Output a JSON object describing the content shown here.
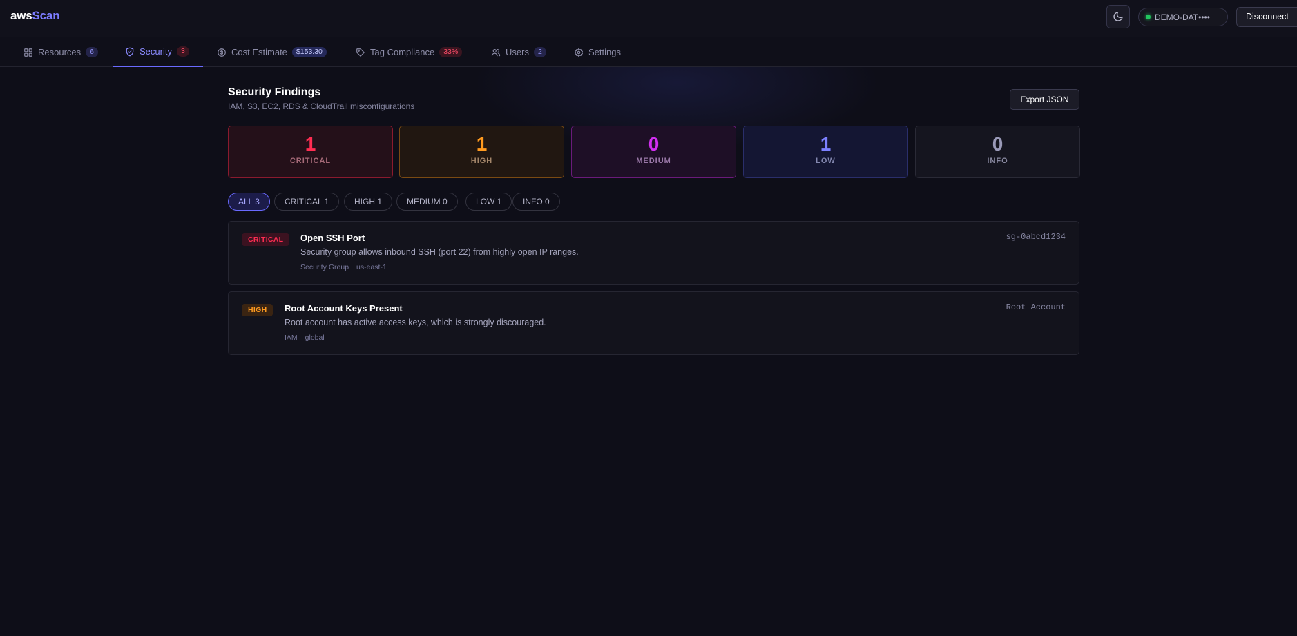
{
  "app": {
    "logo_part1": "aws",
    "logo_part2": "Scan"
  },
  "topbar": {
    "theme_toggle_icon": "moon-icon",
    "account": {
      "label": "DEMO-DAT••••",
      "status": "connected",
      "status_color": "#22c55e"
    },
    "disconnect_label": "Disconnect"
  },
  "tabs": [
    {
      "label": "Resources",
      "badge": "6",
      "icon": "grid-icon",
      "active": false
    },
    {
      "label": "Security",
      "badge": "3",
      "icon": "shield-icon",
      "active": true
    },
    {
      "label": "Cost Estimate",
      "badge": "$153.30",
      "icon": "dollar-icon",
      "active": false
    },
    {
      "label": "Tag Compliance",
      "badge": "33%",
      "icon": "tag-icon",
      "active": false
    },
    {
      "label": "Users",
      "badge": "2",
      "icon": "users-icon",
      "active": false
    },
    {
      "label": "Settings",
      "badge": "",
      "icon": "gear-icon",
      "active": false
    }
  ],
  "page": {
    "title": "Security Findings",
    "subtitle": "IAM, S3, EC2, RDS & CloudTrail misconfigurations",
    "export_label": "Export JSON"
  },
  "summary": [
    {
      "count": "1",
      "label": "CRITICAL",
      "color": "#ff2d52"
    },
    {
      "count": "1",
      "label": "HIGH",
      "color": "#ff9a1f"
    },
    {
      "count": "0",
      "label": "MEDIUM",
      "color": "#d12ef0"
    },
    {
      "count": "1",
      "label": "LOW",
      "color": "#7c80ff"
    },
    {
      "count": "0",
      "label": "INFO",
      "color": "#9a9ab8"
    }
  ],
  "filters": [
    {
      "label": "ALL 3",
      "active": true
    },
    {
      "label": "CRITICAL 1",
      "active": false
    },
    {
      "label": "HIGH 1",
      "active": false
    },
    {
      "label": "MEDIUM 0",
      "active": false
    },
    {
      "label": "LOW 1",
      "active": false
    },
    {
      "label": "INFO 0",
      "active": false
    }
  ],
  "findings": [
    {
      "severity": "CRITICAL",
      "title": "Open SSH Port",
      "description": "Security group allows inbound SSH (port 22) from highly open IP ranges.",
      "service": "Security Group",
      "region": "us-east-1",
      "resource": "sg-0abcd1234"
    },
    {
      "severity": "HIGH",
      "title": "Root Account Keys Present",
      "description": "Root account has active access keys, which is strongly discouraged.",
      "service": "IAM",
      "region": "global",
      "resource": "Root Account"
    }
  ]
}
